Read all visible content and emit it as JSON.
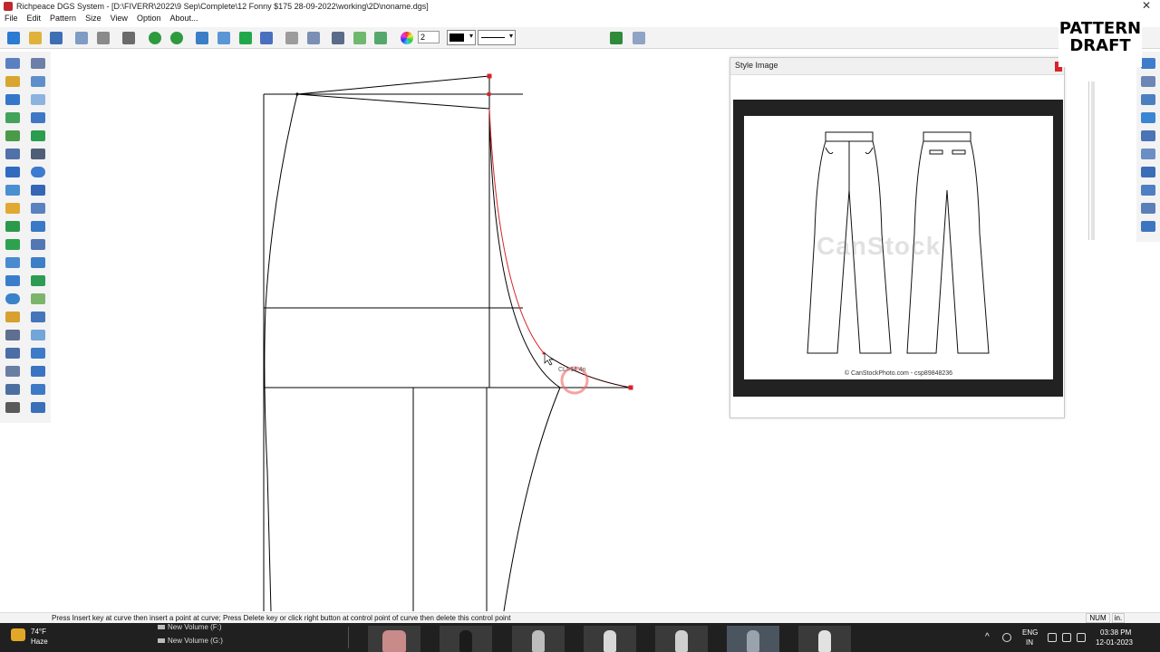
{
  "window": {
    "title": "Richpeace DGS System - [D:\\FIVERR\\2022\\9 Sep\\Complete\\12 Fonny $175 28-09-2022\\working\\2D\\noname.dgs]",
    "close_glyph": "✕"
  },
  "menu": [
    "File",
    "Edit",
    "Pattern",
    "Size",
    "View",
    "Option",
    "About..."
  ],
  "toolbar": {
    "line_width_value": "2",
    "line_color": "#000000",
    "icons": [
      "new-file-icon",
      "open-folder-icon",
      "save-icon",
      "eraser-icon",
      "camera-icon",
      "print-icon",
      "undo-icon",
      "redo-icon",
      "grid-icon",
      "table-icon",
      "shape-icon",
      "bucket-icon",
      "pen-icon",
      "ruler-icon",
      "points-icon",
      "curve-icon",
      "wave-icon",
      "color-wheel-icon",
      "layers-icon",
      "help-icon"
    ]
  },
  "overlay": {
    "line1": "PATTERN",
    "line2": "DRAFT"
  },
  "style_panel": {
    "title": "Style Image",
    "watermark": "CanStock",
    "credit": "© CanStockPhoto.com - csp89848236"
  },
  "canvas": {
    "measure_label": "CL=14.4n",
    "accent_color": "#d8232a"
  },
  "status": {
    "message": "Press Insert key at curve then insert a point at curve; Press  Delete key or click right button at control point of curve then delete this control point",
    "num": "NUM",
    "unit": "in."
  },
  "taskbar": {
    "temperature": "74°F",
    "condition": "Haze",
    "drive_f": "New Volume (F:)",
    "drive_g": "New Volume (G:)",
    "lang": "ENG",
    "region": "IN",
    "time": "03:38 PM",
    "date": "12-01-2023"
  }
}
